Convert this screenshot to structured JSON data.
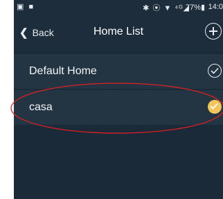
{
  "status_bar": {
    "left_icons": "▣ ■",
    "right_icons": "✱ ⦿ ▼ ⁴ᴳ◢",
    "battery": "77%▮",
    "time": "14:0"
  },
  "nav": {
    "back_label": "Back",
    "title": "Home List"
  },
  "homes": [
    {
      "name": "Default Home",
      "selected": false
    },
    {
      "name": "casa",
      "selected": true
    }
  ],
  "colors": {
    "background": "#1b2a38",
    "row": "#233443",
    "accent_check": "#f2c55a",
    "annotation": "#e02020"
  }
}
